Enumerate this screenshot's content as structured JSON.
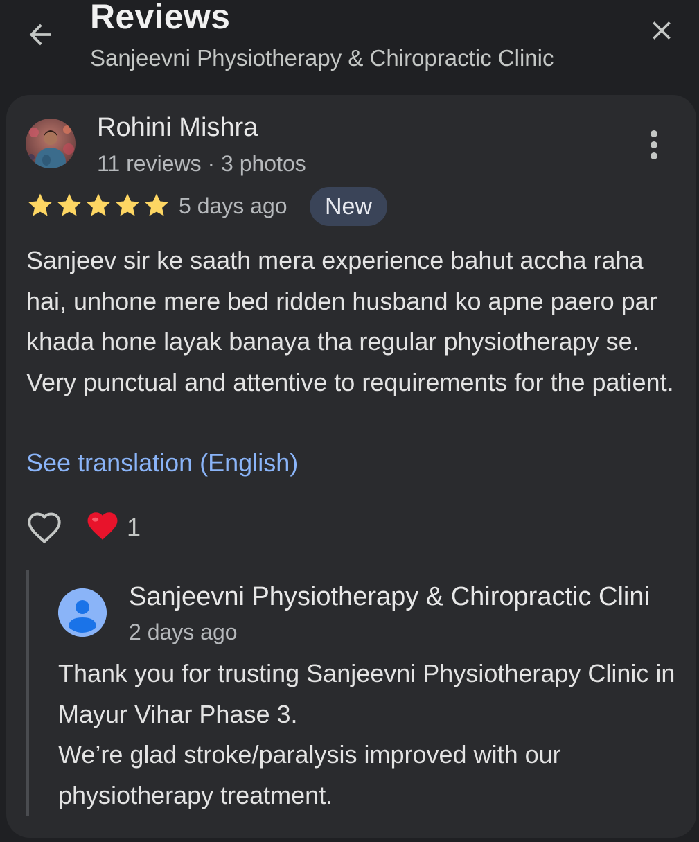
{
  "header": {
    "title": "Reviews",
    "subtitle": "Sanjeevni Physiotherapy & Chiropractic Clinic"
  },
  "review": {
    "reviewer_name": "Rohini Mishra",
    "reviewer_meta": "11 reviews · 3 photos",
    "rating": 5,
    "max_rating": 5,
    "date": "5 days ago",
    "badge": "New",
    "text": "Sanjeev sir ke saath mera experience bahut accha raha hai, unhone mere bed ridden husband ko apne paero par khada hone layak banaya tha regular physiotherapy se. Very punctual and attentive to requirements for the patient.",
    "translate_link": "See translation (English)",
    "reaction_emoji": "❤️",
    "reaction_count": "1"
  },
  "owner_reply": {
    "name": "Sanjeevni Physiotherapy & Chiropractic Clini",
    "date": "2 days ago",
    "lines": [
      "Thank you for trusting Sanjeevni Physiotherapy Clinic in Mayur Vihar Phase 3.",
      "We’re glad stroke/paralysis improved with our physiotherapy treatment."
    ]
  },
  "icons": {
    "back": "arrow-left-icon",
    "close": "close-icon",
    "more": "more-vertical-icon",
    "star": "star-icon",
    "like": "heart-outline-icon",
    "owner_avatar": "person-icon"
  },
  "colors": {
    "background": "#1f2023",
    "card": "#2a2b2e",
    "star": "#fdd663",
    "link": "#8ab4f8",
    "badge": "#3a4458",
    "heart": "#e8132b"
  }
}
